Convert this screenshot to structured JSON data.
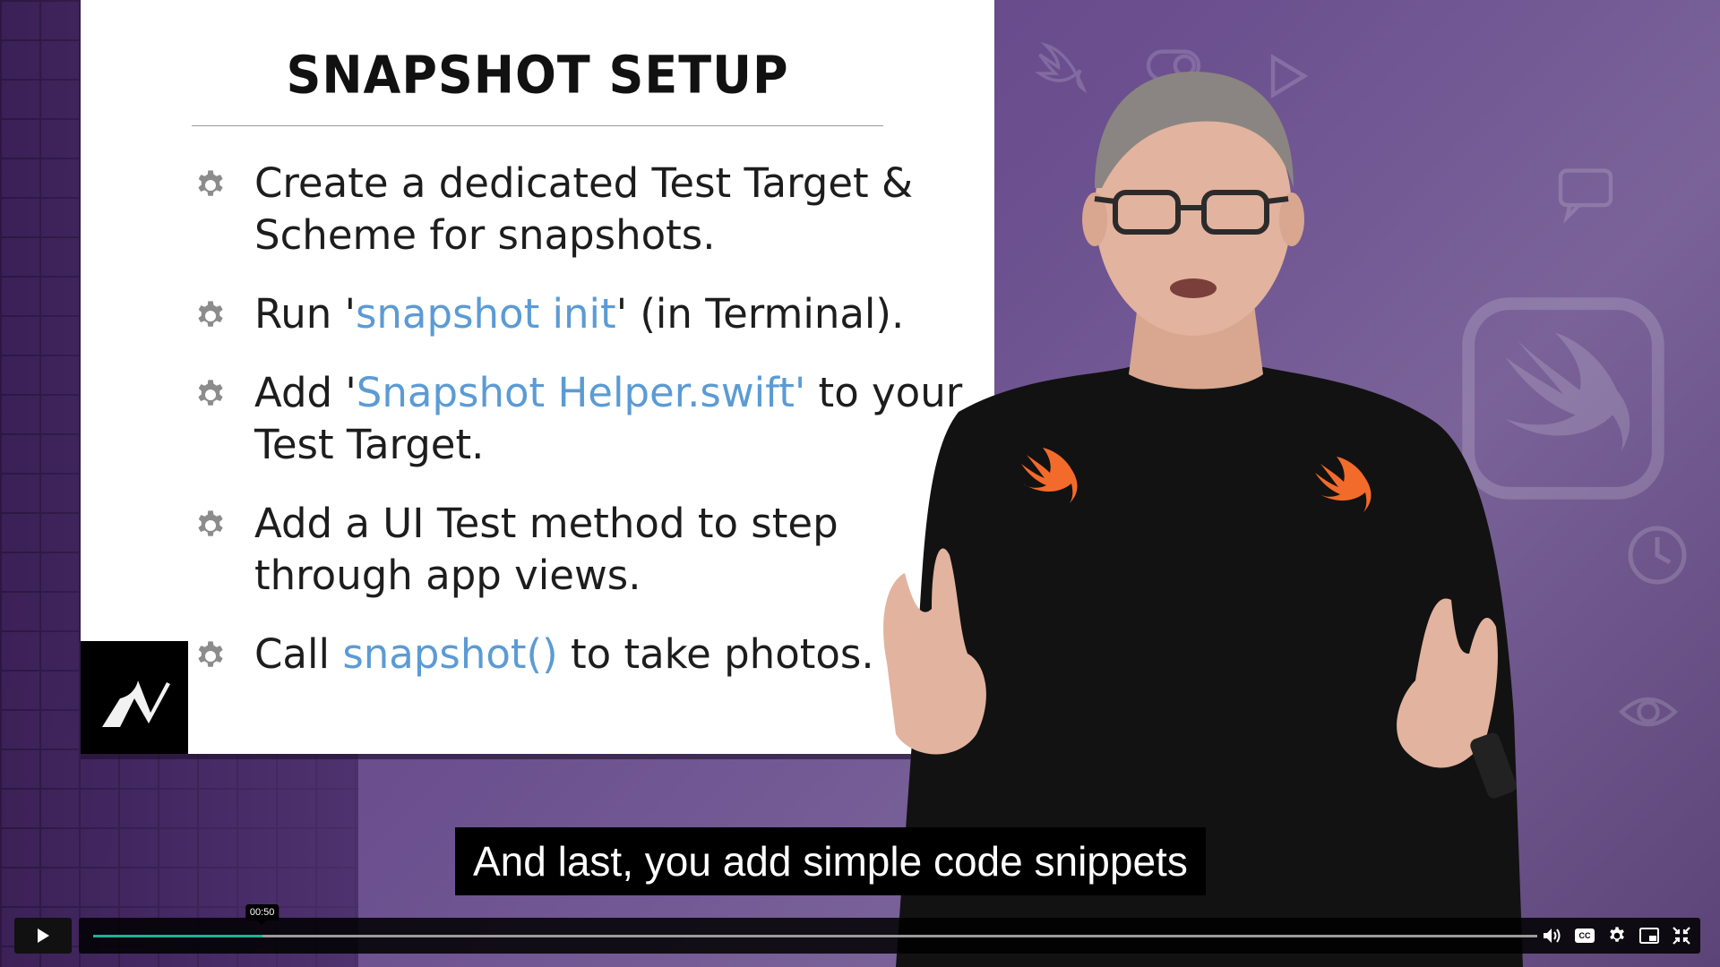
{
  "slide": {
    "title": "SNAPSHOT SETUP",
    "bullets": [
      {
        "parts": [
          {
            "text": "Create a dedicated Test Target & Scheme for snapshots.",
            "accent": false
          }
        ]
      },
      {
        "parts": [
          {
            "text": "Run '",
            "accent": false
          },
          {
            "text": "snapshot init",
            "accent": true
          },
          {
            "text": "' (in Terminal).",
            "accent": false
          }
        ]
      },
      {
        "parts": [
          {
            "text": "Add '",
            "accent": false
          },
          {
            "text": "Snapshot Helper.swift'",
            "accent": true
          },
          {
            "text": " to your Test Target.",
            "accent": false
          }
        ]
      },
      {
        "parts": [
          {
            "text": "Add a UI Test method to step through app views.",
            "accent": false
          }
        ]
      },
      {
        "parts": [
          {
            "text": "Call ",
            "accent": false
          },
          {
            "text": "snapshot()",
            "accent": true
          },
          {
            "text": " to take photos.",
            "accent": false
          }
        ]
      }
    ],
    "bullet_icon": "gear-icon",
    "accent_color": "#5b9bd5"
  },
  "caption": {
    "text": "And last, you add simple code snippets"
  },
  "player": {
    "time_tooltip": "00:50",
    "progress": 0.117,
    "progress_color": "#19b494",
    "buttons": {
      "play": "play-icon",
      "volume": "volume-icon",
      "captions": "CC",
      "settings": "gear-icon",
      "pip": "picture-in-picture-icon",
      "exit_fullscreen": "exit-fullscreen-icon"
    }
  }
}
